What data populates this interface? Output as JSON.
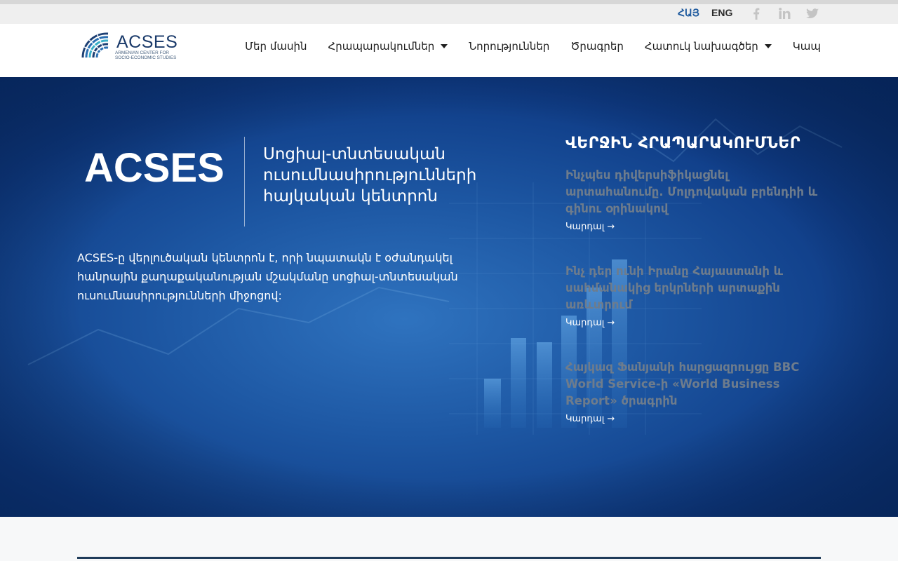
{
  "topbar": {
    "languages": [
      {
        "label": "ՀԱՅ",
        "active": true
      },
      {
        "label": "ENG",
        "active": false
      }
    ],
    "social": [
      "facebook-icon",
      "linkedin-icon",
      "twitter-icon"
    ]
  },
  "header": {
    "logo_text": "ACSES",
    "logo_subtitle_1": "ARMENIAN CENTER FOR",
    "logo_subtitle_2": "SOCIO-ECONOMIC STUDIES",
    "nav": [
      {
        "label": "Մեր մասին",
        "dropdown": false
      },
      {
        "label": "Հրապարակումներ",
        "dropdown": true
      },
      {
        "label": "Նորություններ",
        "dropdown": false
      },
      {
        "label": "Ծրագրեր",
        "dropdown": false
      },
      {
        "label": "Հատուկ նախագծեր",
        "dropdown": true
      },
      {
        "label": "Կապ",
        "dropdown": false
      }
    ]
  },
  "hero": {
    "brand": "ACSES",
    "tagline": "Սոցիալ-տնտեսական ուսումնասիրությունների հայկական կենտրոն",
    "description": "ACSES-ը վերլուծական կենտրոն է, որի նպատակն է օժանդակել հանրային քաղաքականության մշակմանը սոցիալ-տնտեսական ուսումնասիրությունների միջոցով:"
  },
  "latest": {
    "heading": "ՎԵՐՋԻՆ ՀՐԱՊԱՐԱԿՈՒՄՆԵՐ",
    "posts": [
      {
        "title": "Ինչպես դիվերսիֆիկացնել արտահանումը. Մոլդովական բրենդիի և գինու օրինակով",
        "more": "Կարդալ →"
      },
      {
        "title": "Ինչ դեր ունի Իրանը Հայաստանի և սահմանակից երկրների արտաքին առևտրում",
        "more": "Կարդալ →"
      },
      {
        "title": "Հայկազ Ֆանյանի հարցազրույցը BBC World Service-ի «World Business Report» ծրագրին",
        "more": "Կարդալ →"
      }
    ]
  },
  "colors": {
    "accent": "#1e5a9e",
    "hero_dark": "#082c6b",
    "post_title": "#6e7c8c"
  }
}
